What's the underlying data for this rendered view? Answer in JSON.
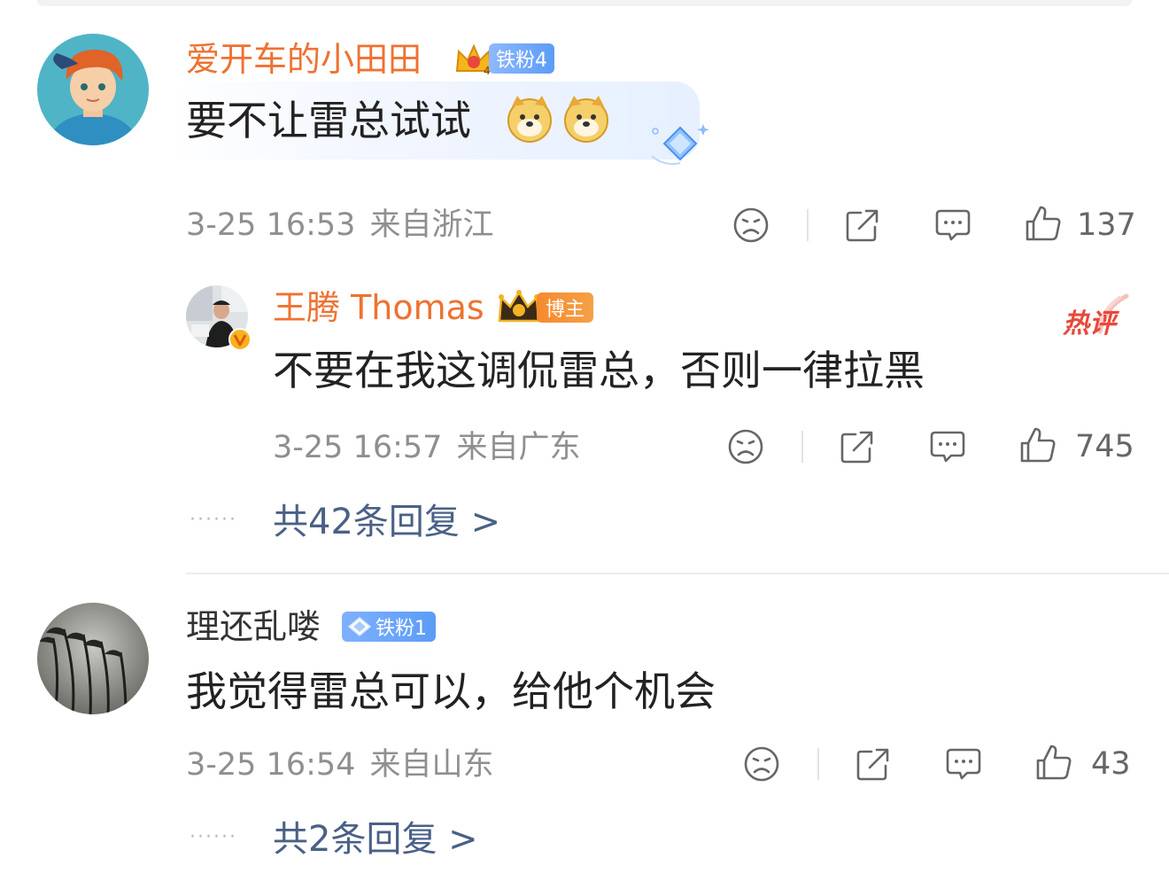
{
  "comments": [
    {
      "username": "爱开车的小田田",
      "badge": "铁粉4",
      "text": "要不让雷总试试",
      "time": "3-25 16:53",
      "location": "来自浙江",
      "likes": "137",
      "reply": {
        "username": "王腾 Thomas",
        "badge": "博主",
        "hot_tag": "热评",
        "text": "不要在我这调侃雷总，否则一律拉黑",
        "time": "3-25 16:57",
        "location": "来自广东",
        "likes": "745"
      },
      "more_replies": "共42条回复 >"
    },
    {
      "username": "理还乱喽",
      "badge": "铁粉1",
      "text": "我觉得雷总可以，给他个机会",
      "time": "3-25 16:54",
      "location": "来自山东",
      "likes": "43",
      "more_replies": "共2条回复 >"
    }
  ],
  "dots": "······",
  "icons": [
    "dislike-face-icon",
    "share-icon",
    "comment-icon",
    "thumbs-up-icon",
    "doge-emoji-icon",
    "diamond-decoration-icon",
    "crown-icon",
    "verified-v-icon"
  ],
  "colors": {
    "username_orange": "#ee7231",
    "link_blue": "#4a6087",
    "meta_gray": "#8f8f8f",
    "badge_blue": "#5b9cf6",
    "badge_orange": "#f7892e",
    "hot_red": "#e8483b"
  }
}
